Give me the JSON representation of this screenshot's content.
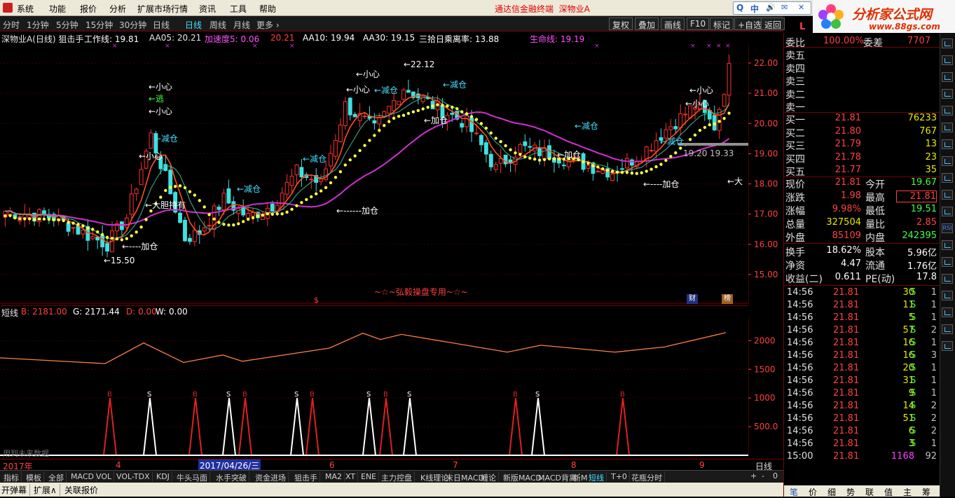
{
  "menu": {
    "items": [
      "系统",
      "功能",
      "报价",
      "分析",
      "扩展市场行情",
      "资讯",
      "工具",
      "帮助"
    ],
    "terminal_title": "通达信金融终端",
    "stock_name": "深物业A"
  },
  "search": {
    "buttons": [
      "Q",
      "中",
      "🔊",
      "✉",
      "✕"
    ]
  },
  "logo": {
    "title": "分析家公式网",
    "url": "www.88gs.com"
  },
  "periods": [
    "分时",
    "1分钟",
    "5分钟",
    "15分钟",
    "30分钟",
    "日线",
    "周线",
    "月线",
    "更多 ›"
  ],
  "active_period": "日线",
  "tool_buttons": [
    "复权",
    "叠加",
    "画线",
    "F10",
    "标记",
    "+自选",
    "返回"
  ],
  "indicator_line": {
    "name": "深物业A(日线) 狙击手",
    "items": [
      {
        "label": "工作线: 19.81",
        "color": "#ffffff"
      },
      {
        "label": "AA05: 20.21",
        "color": "#e8e8e8"
      },
      {
        "label": "加速度5: 0.06",
        "color": "#ff50ff"
      },
      {
        "label": "20.21",
        "color": "#ff4040"
      },
      {
        "label": "AA10: 19.94",
        "color": "#ffffff"
      },
      {
        "label": "AA30: 19.15",
        "color": "#ffffff"
      },
      {
        "label": "三拾日乘离率: 13.88",
        "color": "#ffffff"
      },
      {
        "label": "生命线: 19.19",
        "color": "#ff50ff"
      }
    ]
  },
  "price_axis": [
    "22.00",
    "21.00",
    "20.00",
    "19.00",
    "18.00",
    "17.00",
    "16.00",
    "15.00"
  ],
  "chart_annotations": [
    {
      "text": "←小心",
      "color": "#ffffff"
    },
    {
      "text": "←逃",
      "color": "#40ff40"
    },
    {
      "text": "←小心",
      "color": "#ffffff"
    },
    {
      "text": "←减仓",
      "color": "#40e0ff"
    },
    {
      "text": "←小心",
      "color": "#ffffff"
    },
    {
      "text": "←大胆持有",
      "color": "#ffffff"
    },
    {
      "text": "←----加仓",
      "color": "#ffffff"
    },
    {
      "text": "←15.50",
      "color": "#ffffff"
    },
    {
      "text": "←减仓",
      "color": "#40e0ff"
    },
    {
      "text": "←减仓",
      "color": "#40e0ff"
    },
    {
      "text": "←------加仓",
      "color": "#ffffff"
    },
    {
      "text": "←小心",
      "color": "#ffffff"
    },
    {
      "text": "←小心",
      "color": "#ffffff"
    },
    {
      "text": "←减仓",
      "color": "#40e0ff"
    },
    {
      "text": "←22.12",
      "color": "#ffffff"
    },
    {
      "text": "←减仓",
      "color": "#40e0ff"
    },
    {
      "text": "←加仓",
      "color": "#ffffff"
    },
    {
      "text": "←减仓",
      "color": "#40e0ff"
    },
    {
      "text": "←加仓",
      "color": "#ffffff"
    },
    {
      "text": "←小心",
      "color": "#ffffff"
    },
    {
      "text": "←小心",
      "color": "#ffffff"
    },
    {
      "text": "←减仓",
      "color": "#40e0ff"
    },
    {
      "text": "19.20",
      "color": "#c0c0c0"
    },
    {
      "text": "19.33",
      "color": "#c0c0c0"
    },
    {
      "text": "←----加仓",
      "color": "#ffffff"
    },
    {
      "text": "←大",
      "color": "#ffffff"
    }
  ],
  "watermark": "~☆~弘毅操盘专用~☆~",
  "marker_s": "$",
  "badges": [
    "财",
    "榜"
  ],
  "sub_indicator": {
    "name": "短线",
    "items": [
      {
        "label": "B: 2181.00",
        "color": "#ff4040"
      },
      {
        "label": "G: 2171.44",
        "color": "#ffffff"
      },
      {
        "label": "D: 0.00",
        "color": "#ff4040"
      },
      {
        "label": "W: 0.00",
        "color": "#ffffff"
      }
    ]
  },
  "sub_axis": [
    "2000",
    "1500",
    "1000",
    "500.0"
  ],
  "signal_labels": [
    "B",
    "S",
    "B",
    "S",
    "B",
    "S",
    "B",
    "S",
    "B",
    "S",
    "B",
    "B",
    "S",
    "B"
  ],
  "future_note": "用到未来数据",
  "time_axis": {
    "year": "2017年",
    "months": [
      "4",
      "5",
      "6",
      "7",
      "8",
      "9"
    ],
    "cursor_date": "2017/04/26/三",
    "period": "日线"
  },
  "indicator_tabs": [
    "指标",
    "模板",
    "全部",
    "MACD",
    "VOL",
    "VOL-TDX",
    "KDJ",
    "牛头马面",
    "水手突破",
    "资金进场",
    "狙击手",
    "MA2",
    "XT",
    "ENE",
    "主力控盘",
    "K线理论",
    "末日MACD",
    "缠论",
    "新版MACD",
    "MACD背离",
    "新M",
    "短线",
    "T+0",
    "花瓶分时"
  ],
  "active_tab": "短线",
  "tab_controls": [
    "+",
    "-",
    "0"
  ],
  "bottom_buttons": [
    "开弹幕",
    "扩展∧",
    "关联报价"
  ],
  "quote": {
    "exchange_flag": "L",
    "ratio": {
      "label": "委比",
      "value": "100.00%",
      "diff_label": "委差",
      "diff": "7707"
    },
    "sells": [
      {
        "label": "卖五"
      },
      {
        "label": "卖四"
      },
      {
        "label": "卖三"
      },
      {
        "label": "卖二"
      },
      {
        "label": "卖一"
      }
    ],
    "buys": [
      {
        "label": "买一",
        "price": "21.81",
        "vol": "76233"
      },
      {
        "label": "买二",
        "price": "21.80",
        "vol": "767"
      },
      {
        "label": "买三",
        "price": "21.79",
        "vol": "13"
      },
      {
        "label": "买四",
        "price": "21.78",
        "vol": "23"
      },
      {
        "label": "买五",
        "price": "21.77",
        "vol": "35"
      }
    ],
    "stats": [
      {
        "l1": "现价",
        "v1": "21.81",
        "c1": "#ff4040",
        "l2": "今开",
        "v2": "19.67",
        "c2": "#40ff40"
      },
      {
        "l1": "涨跌",
        "v1": "1.98",
        "c1": "#ff4040",
        "l2": "最高",
        "v2": "21.81",
        "c2": "#ff4040"
      },
      {
        "l1": "涨幅",
        "v1": "9.98%",
        "c1": "#ff4040",
        "l2": "最低",
        "v2": "19.51",
        "c2": "#40ff40"
      },
      {
        "l1": "总量",
        "v1": "327504",
        "c1": "#e8e800",
        "l2": "量比",
        "v2": "2.85",
        "c2": "#ff4040"
      },
      {
        "l1": "外盘",
        "v1": "85109",
        "c1": "#ff4040",
        "l2": "内盘",
        "v2": "242395",
        "c2": "#40ff40"
      },
      {
        "l1": "换手",
        "v1": "18.62%",
        "c1": "#ffffff",
        "l2": "股本",
        "v2": "5.96亿",
        "c2": "#ffffff"
      },
      {
        "l1": "净资",
        "v1": "4.47",
        "c1": "#ffffff",
        "l2": "流通",
        "v2": "1.76亿",
        "c2": "#ffffff"
      },
      {
        "l1": "收益(二)",
        "v1": "0.611",
        "c1": "#ffffff",
        "l2": "PE(动)",
        "v2": "17.8",
        "c2": "#ffffff"
      }
    ],
    "ticks": [
      {
        "t": "14:56",
        "p": "21.81",
        "v": "30",
        "f": "S",
        "n": "1"
      },
      {
        "t": "14:56",
        "p": "21.81",
        "v": "11",
        "f": "S",
        "n": "1"
      },
      {
        "t": "14:56",
        "p": "21.81",
        "v": "5",
        "f": "S",
        "n": "1"
      },
      {
        "t": "14:56",
        "p": "21.81",
        "v": "57",
        "f": "S",
        "n": "2"
      },
      {
        "t": "14:56",
        "p": "21.81",
        "v": "16",
        "f": "S",
        "n": "1"
      },
      {
        "t": "14:56",
        "p": "21.81",
        "v": "16",
        "f": "S",
        "n": "3"
      },
      {
        "t": "14:56",
        "p": "21.81",
        "v": "20",
        "f": "S",
        "n": "1"
      },
      {
        "t": "14:56",
        "p": "21.81",
        "v": "31",
        "f": "S",
        "n": "1"
      },
      {
        "t": "14:56",
        "p": "21.81",
        "v": "9",
        "f": "S",
        "n": "1"
      },
      {
        "t": "14:56",
        "p": "21.81",
        "v": "14",
        "f": "S",
        "n": "2"
      },
      {
        "t": "14:56",
        "p": "21.81",
        "v": "51",
        "f": "S",
        "n": "2"
      },
      {
        "t": "14:56",
        "p": "21.81",
        "v": "6",
        "f": "S",
        "n": "2"
      },
      {
        "t": "14:56",
        "p": "21.81",
        "v": "3",
        "f": "S",
        "n": "1"
      },
      {
        "t": "15:00",
        "p": "21.81",
        "v": "1168",
        "f": "",
        "n": "92"
      }
    ],
    "bottom_tabs": [
      "笔",
      "价",
      "细",
      "势",
      "联",
      "值",
      "主",
      "筹"
    ]
  },
  "side_icons": [
    "grid-icon",
    "candle-icon",
    "bar-icon",
    "line-icon",
    "chart-icon",
    "chart2-icon",
    "table-icon",
    "list-icon",
    "info-icon",
    "gauge-icon",
    "flag-icon",
    "rsi-icon",
    "chart3-icon",
    "move-icon",
    "zoom-in-icon",
    "zoom-out-icon",
    "extra1-icon",
    "extra2-icon",
    "extra3-icon"
  ],
  "side_rsi": "RSI",
  "colors": {
    "up": "#ff3030",
    "down": "#40e0e0",
    "ma_life": "#d030d0",
    "dots": "#ffff40",
    "accent": "#ff4040"
  }
}
